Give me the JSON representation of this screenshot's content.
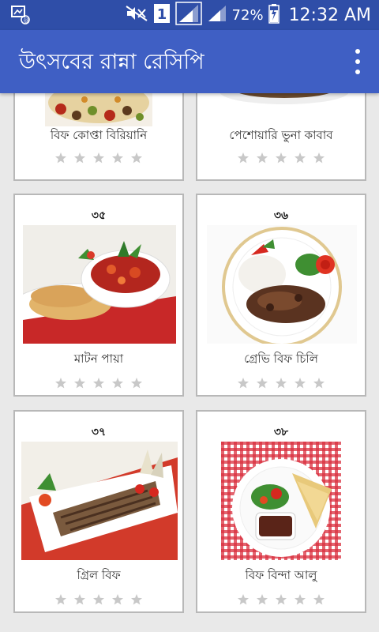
{
  "status_bar": {
    "battery_percent": "72%",
    "clock": "12:32 AM",
    "sim_slot": "1",
    "icons": [
      "screenshot-icon",
      "mute-icon",
      "sim-icon",
      "signal-icon",
      "signal-icon",
      "battery-charging-icon"
    ]
  },
  "app_bar": {
    "title": "উৎসবের রান্না রেসিপি",
    "menu_icon": "overflow-menu-icon"
  },
  "cards": [
    {
      "number": "",
      "name": "বিফ কোপ্তা বিরিয়ানি",
      "rating": 0,
      "max_rating": 5
    },
    {
      "number": "",
      "name": "পেশোয়ারি ভুনা কাবাব",
      "rating": 0,
      "max_rating": 5
    },
    {
      "number": "৩৫",
      "name": "মাটন পায়া",
      "rating": 0,
      "max_rating": 5
    },
    {
      "number": "৩৬",
      "name": "গ্রেভি বিফ চিলি",
      "rating": 0,
      "max_rating": 5
    },
    {
      "number": "৩৭",
      "name": "গ্রিল বিফ",
      "rating": 0,
      "max_rating": 5
    },
    {
      "number": "৩৮",
      "name": "বিফ বিন্দা আলু",
      "rating": 0,
      "max_rating": 5
    }
  ],
  "colors": {
    "status_bar": "#2f4ea8",
    "app_bar": "#3f5fc4",
    "background": "#e9e9e9",
    "star_empty": "#c8c8c8"
  }
}
